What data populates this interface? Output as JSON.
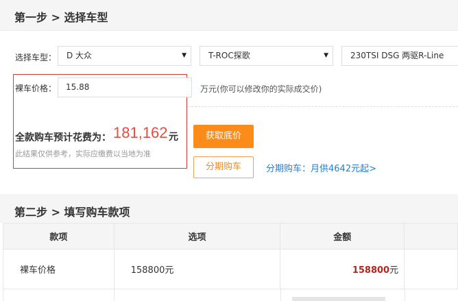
{
  "step1": {
    "title": "第一步 > 选择车型",
    "model_label": "选择车型：",
    "brand_select": "D 大众",
    "series_select": "T-ROC探歌",
    "trim_select": "230TSI DSG 两驱R-Line",
    "price_label": "裸车价格：",
    "price_value": "15.88",
    "price_hint": "万元(你可以修改你的实际成交价)",
    "total_label": "全款购车预计花费为：",
    "total_amount": "181,162",
    "total_unit": "元",
    "disclaimer": "此结果仅供参考，实际应缴费以当地为准",
    "get_price_button": "获取底价",
    "installment_button": "分期购车",
    "installment_link": "分期购车：月供4642元起>"
  },
  "step2": {
    "title": "第二步 > 填写购车款项",
    "columns": [
      "款项",
      "选项",
      "金额",
      ""
    ],
    "rows": [
      {
        "item": "裸车价格",
        "option": "158800元",
        "amount": "158800",
        "amount_unit": "元"
      }
    ]
  },
  "colors": {
    "accent_orange": "#fb8c1a",
    "price_red": "#e84c3d",
    "link_blue": "#2a7ccc",
    "highlight_box": "#d23c3c"
  }
}
